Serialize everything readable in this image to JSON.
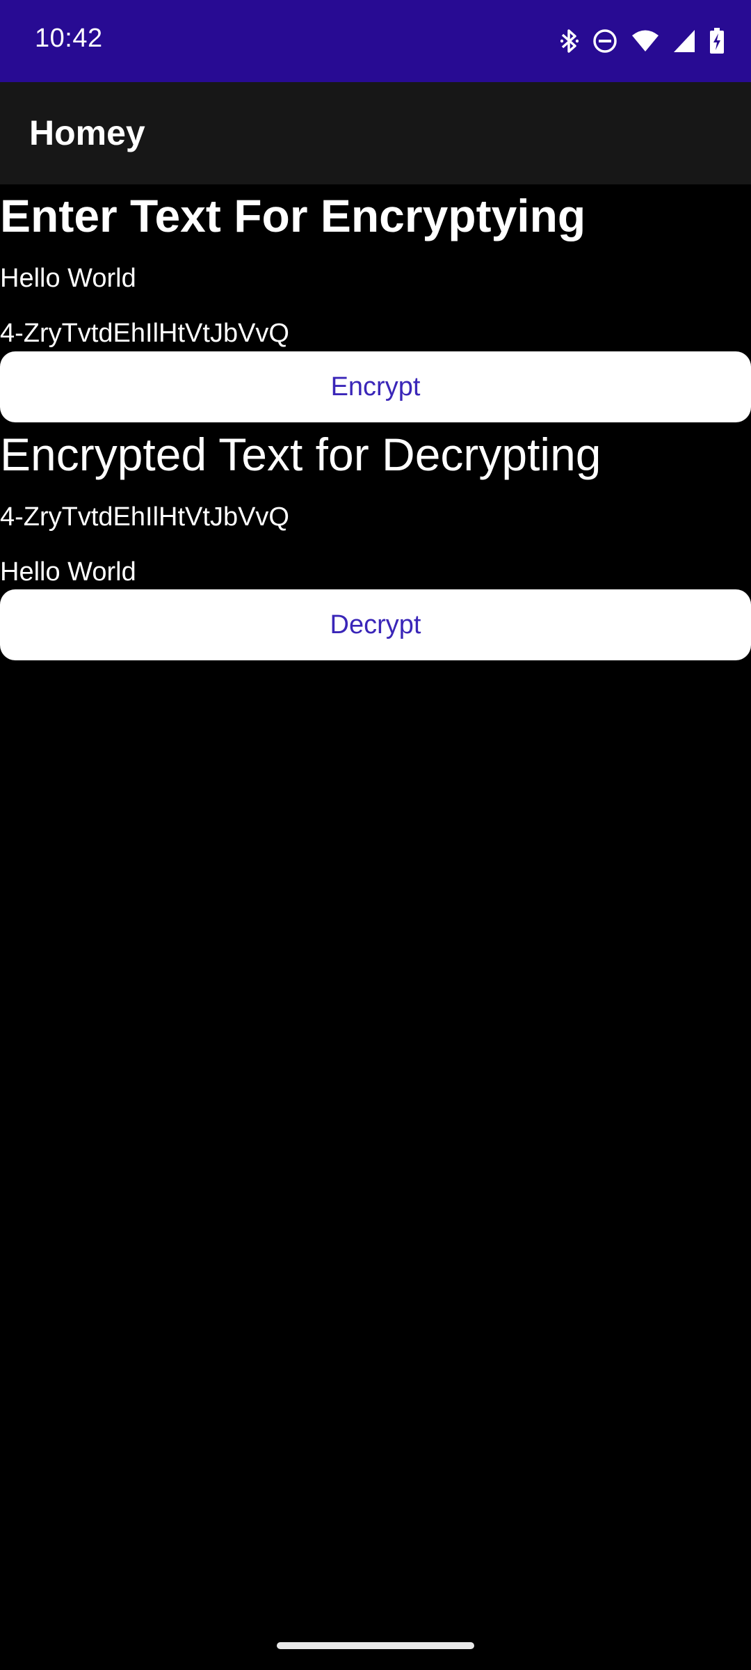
{
  "status_bar": {
    "time": "10:42",
    "background_color": "#280b93",
    "icons": [
      "bluetooth-icon",
      "do-not-disturb-icon",
      "wifi-icon",
      "cellular-signal-icon",
      "battery-charging-icon"
    ]
  },
  "app_bar": {
    "title": "Homey",
    "background_color": "#171717"
  },
  "encrypt_section": {
    "heading": "Enter Text For Encryptying",
    "input_value": "Hello World",
    "output_value": "4-ZryTvtdEhIlHtVtJbVvQ",
    "button_label": "Encrypt"
  },
  "decrypt_section": {
    "heading": "Encrypted Text for Decrypting",
    "input_value": "4-ZryTvtdEhIlHtVtJbVvQ",
    "output_value": "Hello World",
    "button_label": "Decrypt"
  },
  "colors": {
    "page_background": "#000000",
    "text": "#ffffff",
    "button_background": "#ffffff",
    "button_text": "#3a26b8"
  }
}
